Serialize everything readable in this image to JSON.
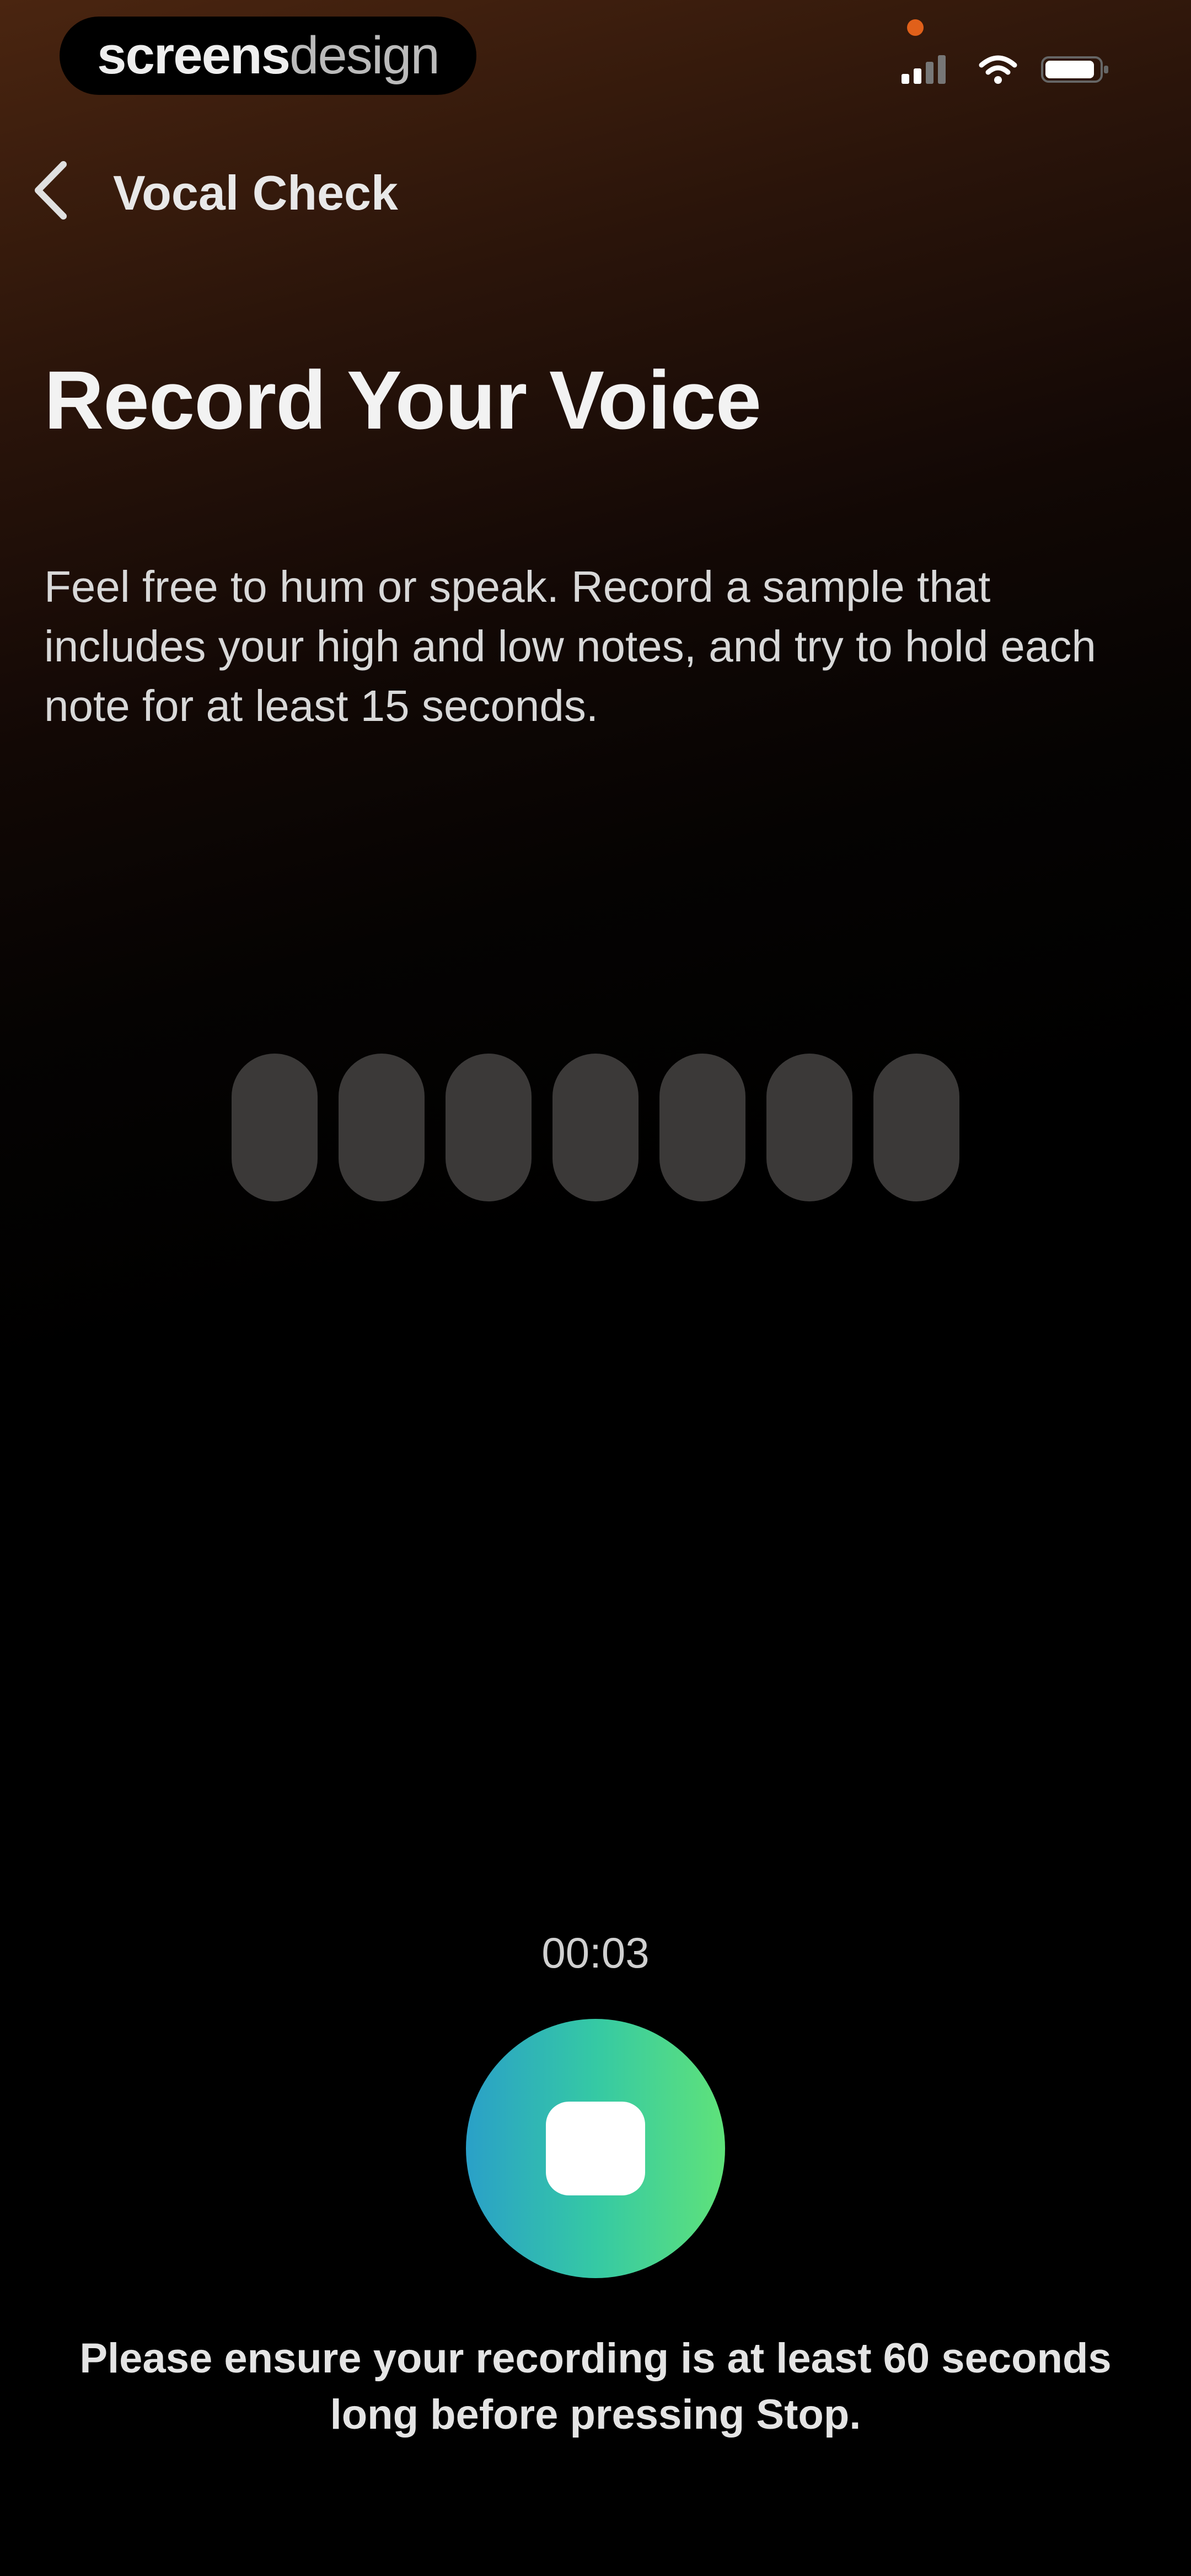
{
  "status_bar": {
    "brand_part1": "screens",
    "brand_part2": "design",
    "icons": [
      "cellular-signal-icon",
      "wifi-icon",
      "battery-icon"
    ]
  },
  "nav": {
    "back_icon": "chevron-left-icon",
    "title": "Vocal Check"
  },
  "content": {
    "title": "Record Your Voice",
    "instructions": "Feel free to hum or speak. Record a sample that includes your high and low notes, and try to hold each note for at least 15 seconds."
  },
  "waveform": {
    "bar_count": 7,
    "bar_color": "#3b3938"
  },
  "recorder": {
    "timer": "00:03",
    "button_icon": "stop-icon",
    "gradient_start": "#2aa0c8",
    "gradient_end": "#5fe27a"
  },
  "footer": {
    "note": "Please ensure your recording is at least 60 seconds long before pressing Stop."
  }
}
